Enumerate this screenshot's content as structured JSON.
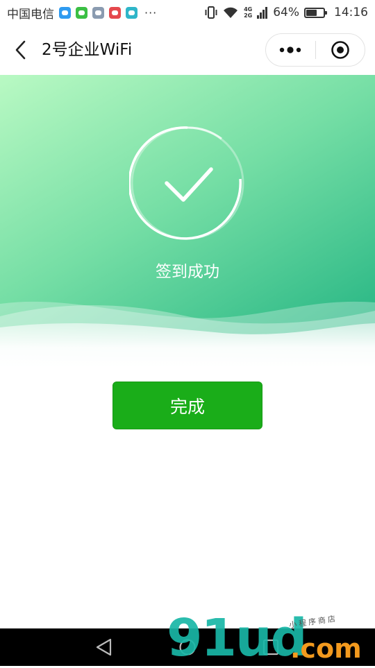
{
  "status_bar": {
    "carrier": "中国电信",
    "apps": [
      {
        "name": "message-app-icon",
        "color": "#2f9bf0"
      },
      {
        "name": "wechat-app-icon",
        "color": "#3bbf44"
      },
      {
        "name": "gallery-app-icon",
        "color": "#8a9bb0"
      },
      {
        "name": "cloud-app-icon",
        "color": "#e5484d"
      },
      {
        "name": "shield-app-icon",
        "color": "#2fb6c9"
      }
    ],
    "more": "···",
    "net_top": "4G",
    "net_bottom": "2G",
    "battery": "64%",
    "battery_level": 0.64,
    "time": "14:16"
  },
  "nav": {
    "title": "2号企业WiFi"
  },
  "hero": {
    "message": "签到成功",
    "colors": {
      "from": "#b9f9c3",
      "to": "#1bb07f"
    }
  },
  "actions": {
    "done_label": "完成",
    "done_color": "#1aad19"
  },
  "watermark": {
    "logo": "91ud",
    "suffix": ".com",
    "tagline": "小程序商店"
  }
}
